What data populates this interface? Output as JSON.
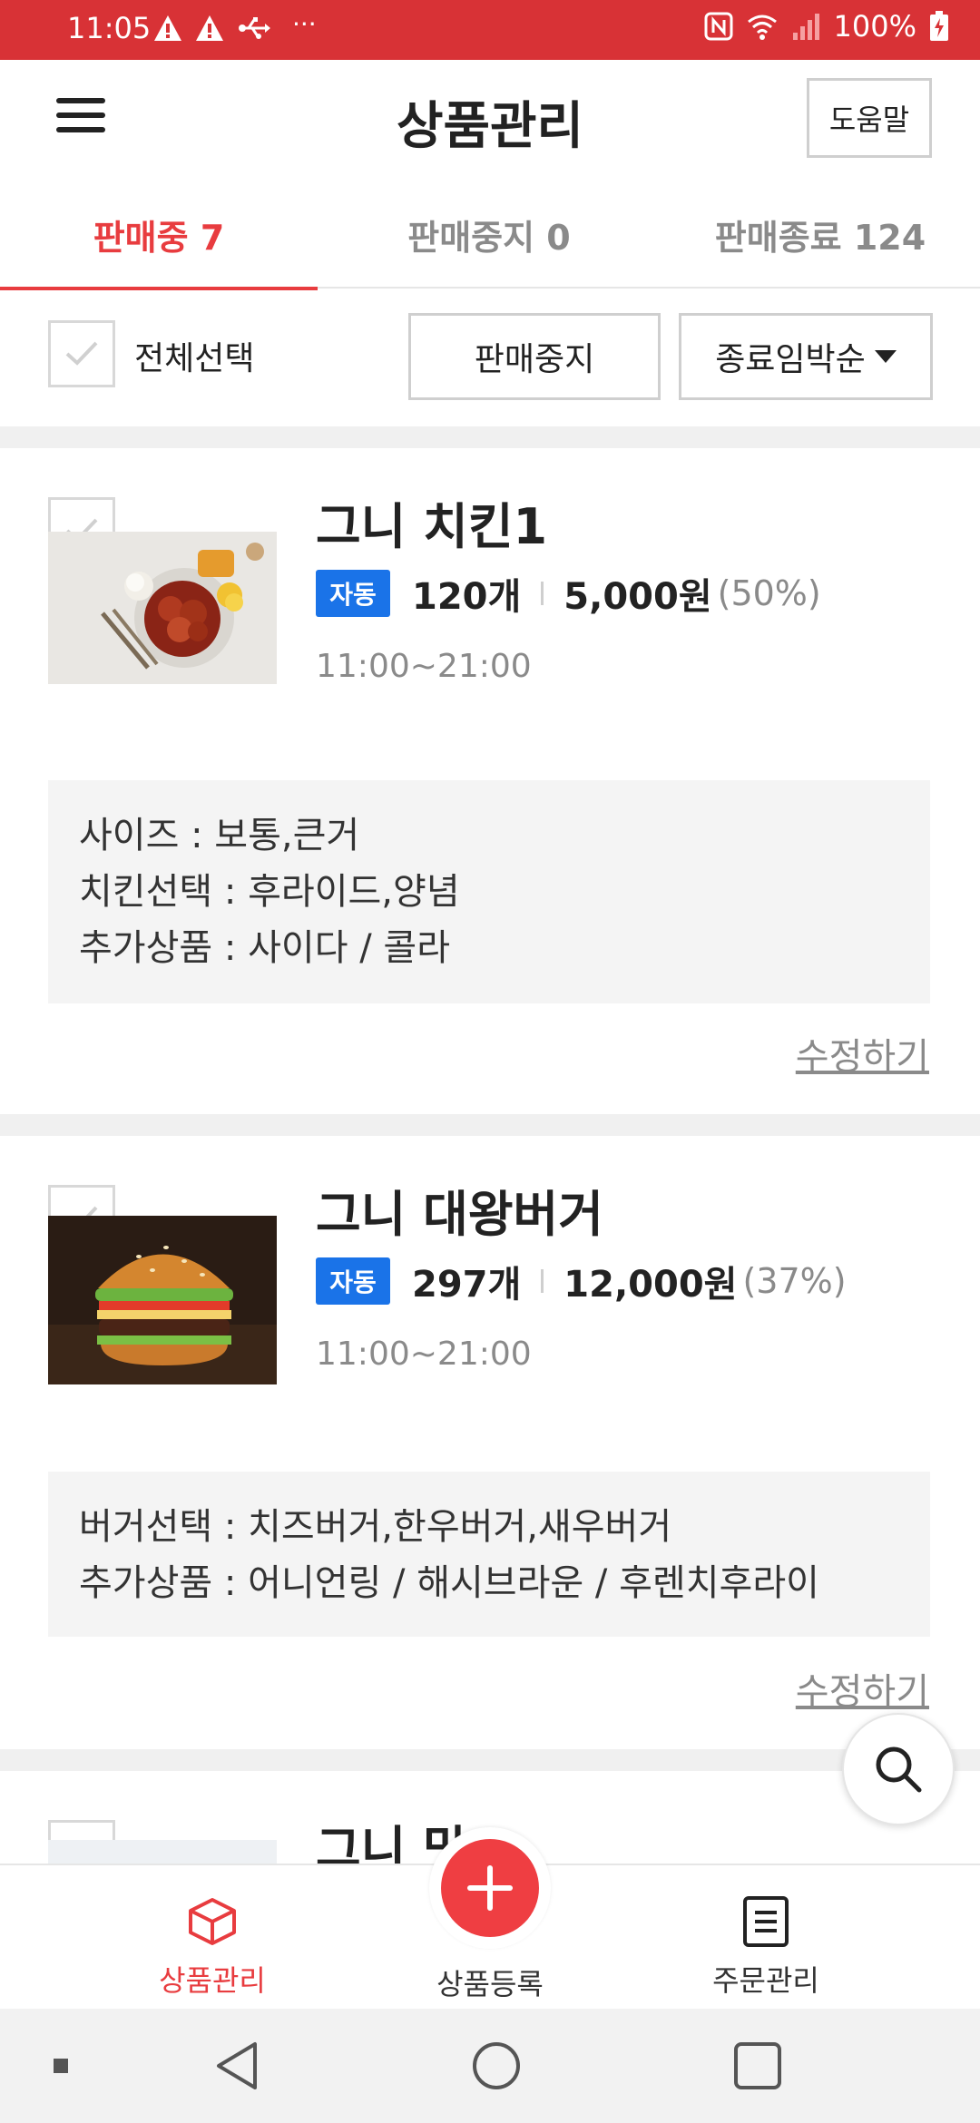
{
  "status_bar": {
    "time": "11:05",
    "dots": "···",
    "battery": "100%"
  },
  "header": {
    "title": "상품관리",
    "help_label": "도움말"
  },
  "tabs": [
    {
      "label": "판매중 7",
      "active": true
    },
    {
      "label": "판매중지 0",
      "active": false
    },
    {
      "label": "판매종료 124",
      "active": false
    }
  ],
  "toolbar": {
    "select_all_label": "전체선택",
    "stop_sale_label": "판매중지",
    "sort_label": "종료임박순"
  },
  "products": [
    {
      "name": "그니 치킨1",
      "badge": "자동",
      "quantity": "120개",
      "price": "5,000원",
      "discount": "(50%)",
      "hours": "11:00~21:00",
      "options": [
        "사이즈 : 보통,큰거",
        "치킨선택 : 후라이드,양념",
        "추가상품 : 사이다 / 콜라"
      ],
      "edit_label": "수정하기"
    },
    {
      "name": "그니 대왕버거",
      "badge": "자동",
      "quantity": "297개",
      "price": "12,000원",
      "discount": "(37%)",
      "hours": "11:00~21:00",
      "options": [
        "버거선택 : 치즈버거,한우버거,새우버거",
        "추가상품 : 어니언링 / 해시브라운 / 후렌치후라이"
      ],
      "edit_label": "수정하기"
    },
    {
      "name": "그니 맛"
    }
  ],
  "bottom_nav": {
    "products_label": "상품관리",
    "register_label": "상품등록",
    "orders_label": "주문관리"
  },
  "colors": {
    "status_bar": "#d83236",
    "accent_red": "#e83c3f",
    "badge_blue": "#1a73e8"
  }
}
